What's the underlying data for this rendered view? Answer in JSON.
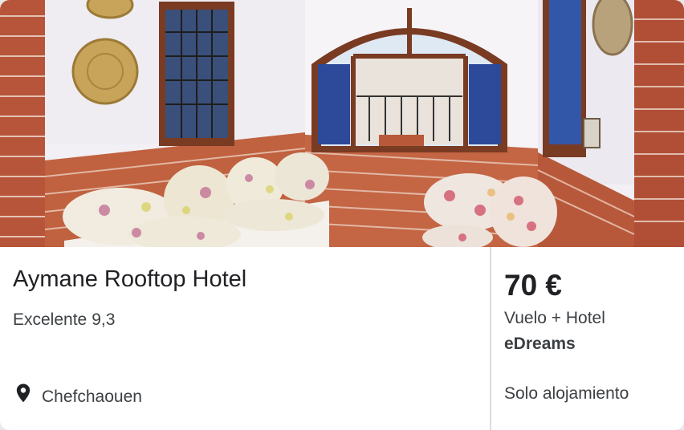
{
  "hotel": {
    "name": "Aymane Rooftop Hotel",
    "rating_label": "Excelente",
    "rating_score": "9,3",
    "location": "Chefchaouen"
  },
  "offer": {
    "price": "70 €",
    "deal_type": "Vuelo + Hotel",
    "provider": "eDreams",
    "board": "Solo alojamiento"
  },
  "icons": {
    "location": "map-pin-icon"
  },
  "colors": {
    "card_background": "#ffffff",
    "divider": "#dadce0",
    "text_primary": "#202124",
    "text_secondary": "#3c4043"
  }
}
